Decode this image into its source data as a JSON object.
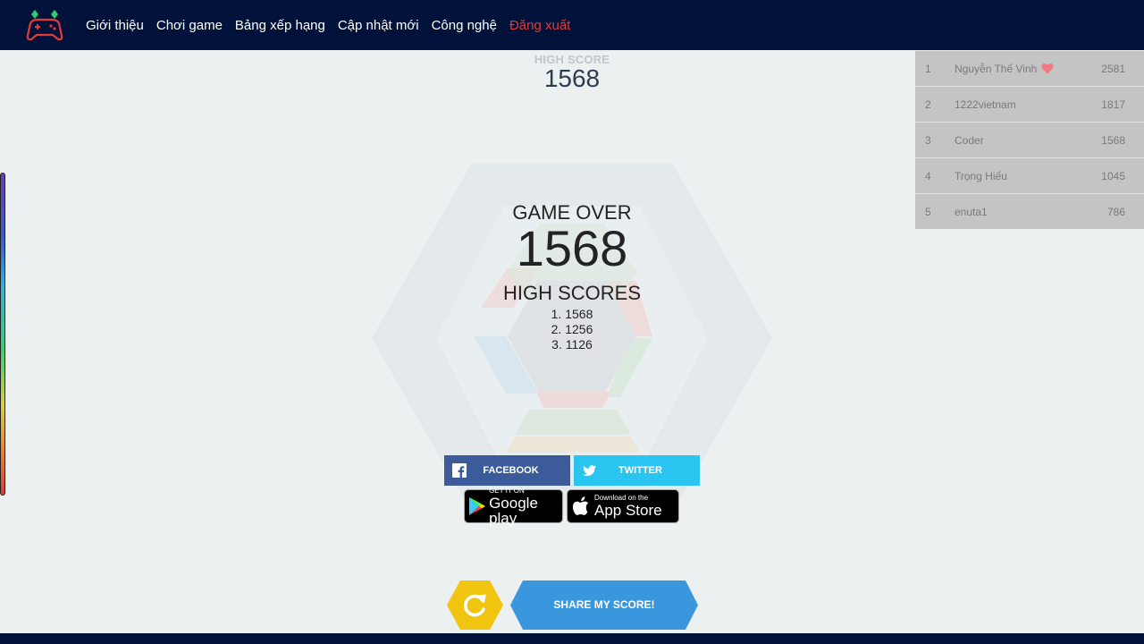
{
  "nav": {
    "logo_icon": "gamepad-logo-icon",
    "links": [
      "Giới thiệu",
      "Chơi game",
      "Bảng xếp hạng",
      "Cập nhật mới",
      "Công nghệ"
    ],
    "logout": "Đăng xuất"
  },
  "header": {
    "high_score_label": "HIGH SCORE",
    "high_score_value": "1568"
  },
  "game_over": {
    "title": "GAME OVER",
    "score": "1568",
    "high_scores_title": "HIGH SCORES",
    "high_scores": [
      "1. 1568",
      "2. 1256",
      "3. 1126"
    ]
  },
  "social": {
    "facebook": "FACEBOOK",
    "twitter": "TWITTER"
  },
  "stores": {
    "google_small": "GET IT ON",
    "google_big": "Google play",
    "apple_small": "Download on the",
    "apple_big": "App Store"
  },
  "actions": {
    "share": "SHARE MY SCORE!",
    "restart_icon": "restart-icon"
  },
  "leaderboard": {
    "rows": [
      {
        "rank": "1",
        "name": "Nguyễn Thế Vinh",
        "score": "2581",
        "heart": true
      },
      {
        "rank": "2",
        "name": "1222vietnam",
        "score": "1817"
      },
      {
        "rank": "3",
        "name": "Coder",
        "score": "1568"
      },
      {
        "rank": "4",
        "name": "Trọng Hiếu",
        "score": "1045"
      },
      {
        "rank": "5",
        "name": "enuta1",
        "score": "786"
      }
    ]
  },
  "colors": {
    "navbar": "#00123a",
    "background": "#ecf0f1",
    "facebook": "#3b5b9a",
    "twitter": "#29c4ef",
    "share": "#3b97dd",
    "restart": "#f1c40f",
    "logout": "#e53935"
  }
}
